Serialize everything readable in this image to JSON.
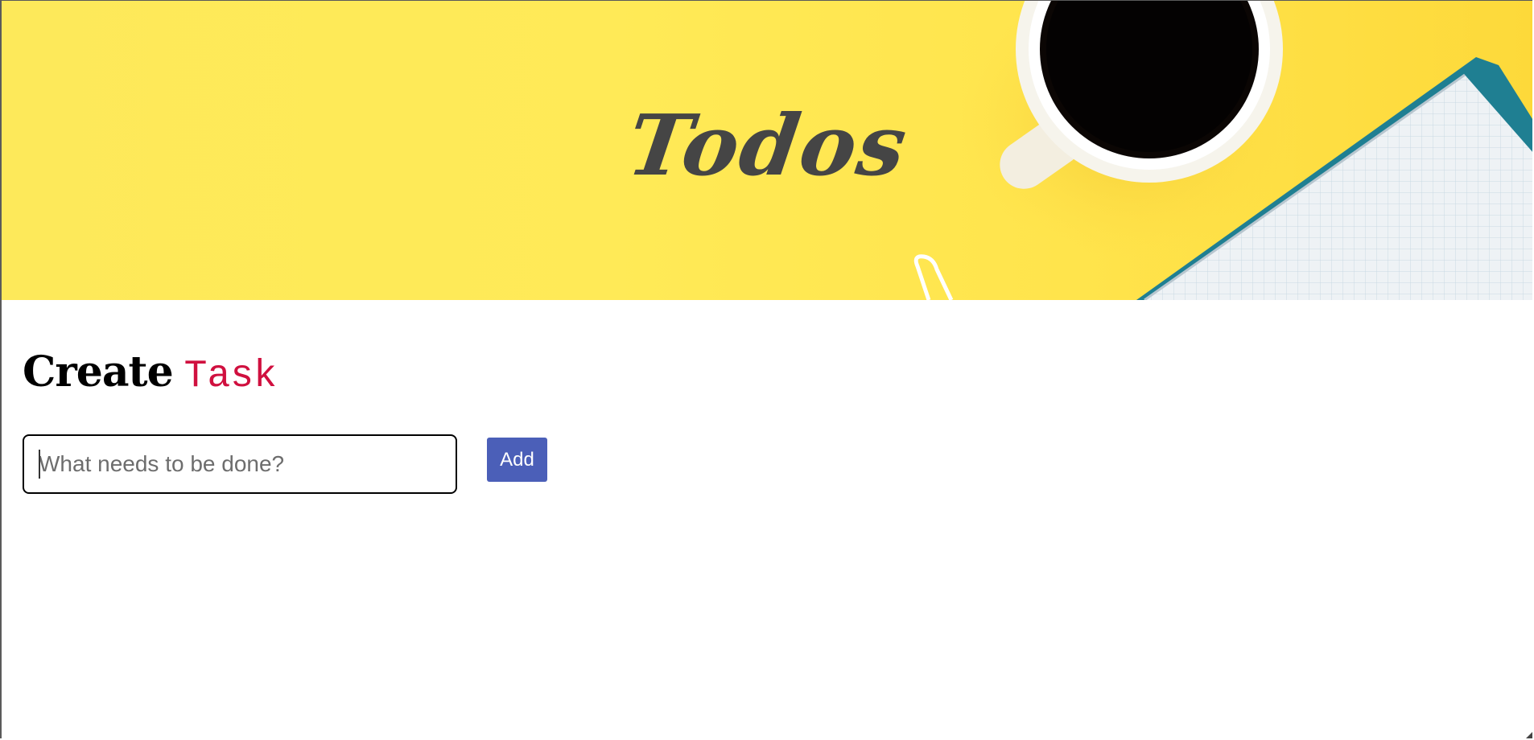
{
  "header": {
    "title": "Todos",
    "background_color": "#ffea57"
  },
  "create_section": {
    "heading_word_1": "Create",
    "heading_word_2": "Task",
    "heading_accent_color": "#d0103f"
  },
  "task_input": {
    "value": "",
    "placeholder": "What needs to be done?"
  },
  "add_button": {
    "label": "Add",
    "color": "#4b5fb8"
  },
  "icons": {
    "hero_decoration": "coffee-cup-notebook-image"
  }
}
